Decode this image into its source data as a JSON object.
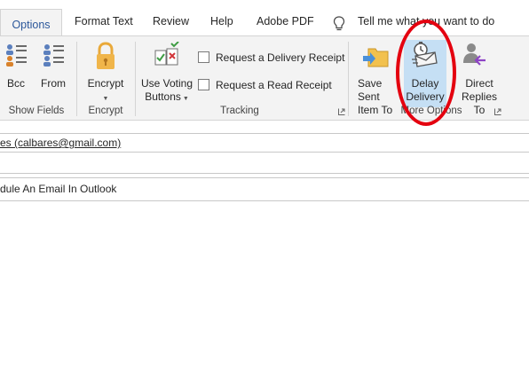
{
  "tabs": [
    {
      "label": "Options"
    },
    {
      "label": "Format Text"
    },
    {
      "label": "Review"
    },
    {
      "label": "Help"
    },
    {
      "label": "Adobe PDF"
    },
    {
      "label": "Tell me what you want to do"
    }
  ],
  "ribbon": {
    "show_fields": {
      "bcc": "Bcc",
      "from": "From",
      "label": "Show Fields"
    },
    "encrypt": {
      "button": "Encrypt",
      "label": "Encrypt"
    },
    "tracking": {
      "voting_line1": "Use Voting",
      "voting_line2": "Buttons",
      "delivery_receipt": "Request a Delivery Receipt",
      "read_receipt": "Request a Read Receipt",
      "label": "Tracking"
    },
    "more_options": {
      "save_sent_line1": "Save Sent",
      "save_sent_line2": "Item To",
      "delay_line1": "Delay",
      "delay_line2": "Delivery",
      "direct_line1": "Direct",
      "direct_line2": "Replies To",
      "label": "More Options"
    }
  },
  "compose": {
    "to_value": "es (calbares@gmail.com)",
    "subject_value": "dule An Email In Outlook"
  },
  "colors": {
    "annotation_circle": "#e4000f",
    "accent": "#2b579a",
    "highlight": "#c5dff4"
  }
}
